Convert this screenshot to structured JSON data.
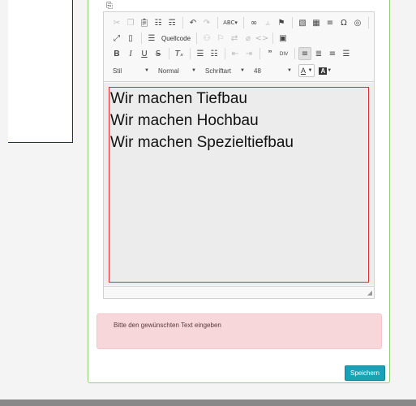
{
  "editor": {
    "top_icon": "copy-icon",
    "toolbar": {
      "row1": [
        "cut-icon",
        "copy-icon",
        "paste-icon",
        "paste-text-icon",
        "paste-word-icon",
        "undo-icon",
        "redo-icon",
        "spellcheck-icon",
        "link-icon",
        "unlink-icon",
        "anchor-icon",
        "image-icon",
        "table-icon",
        "horizontal-line-icon",
        "special-char-icon",
        "iframe-icon"
      ],
      "row2_source_label": "Quellcode",
      "styles": {
        "style_label": "Stil",
        "format_label": "Normal",
        "font_label": "Schriftart",
        "size_label": "48"
      }
    },
    "content_lines": [
      "Wir machen Tiefbau",
      "Wir machen Hochbau",
      "Wir machen Spezieltiefbau"
    ]
  },
  "alert": {
    "text": "Bitte den gewünschten Text eingeben"
  },
  "actions": {
    "save_label": "Speichern"
  },
  "colors": {
    "accent": "#17a2b8",
    "card_border": "#93cf7a",
    "alert_bg": "#f8d7da",
    "content_border": "#e02e2e"
  }
}
